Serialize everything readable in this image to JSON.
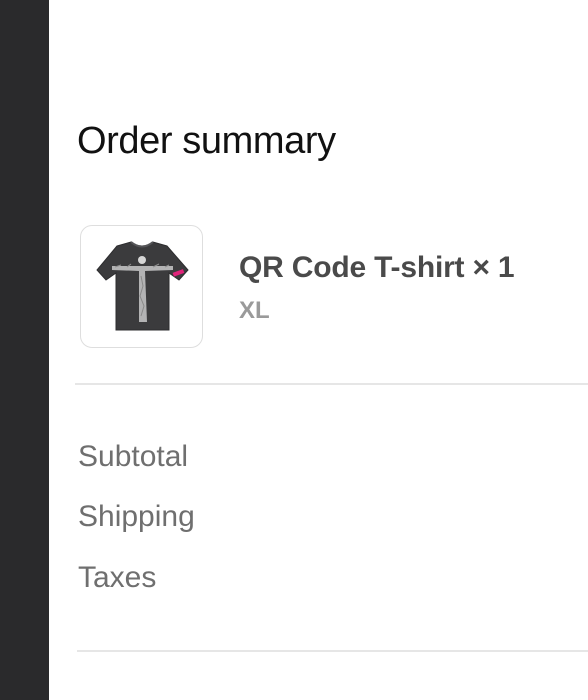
{
  "order_summary": {
    "title": "Order summary",
    "item": {
      "name": "QR Code T-shirt × 1",
      "variant": "XL",
      "thumbnail_icon": "tshirt-image"
    },
    "rows": [
      {
        "label": "Subtotal"
      },
      {
        "label": "Shipping"
      },
      {
        "label": "Taxes"
      }
    ]
  },
  "colors": {
    "left_bar": "#2a2a2c",
    "title": "#111111",
    "product_name": "#4a4a4a",
    "secondary_text": "#6f6f6f",
    "divider": "#e6e6e6"
  }
}
